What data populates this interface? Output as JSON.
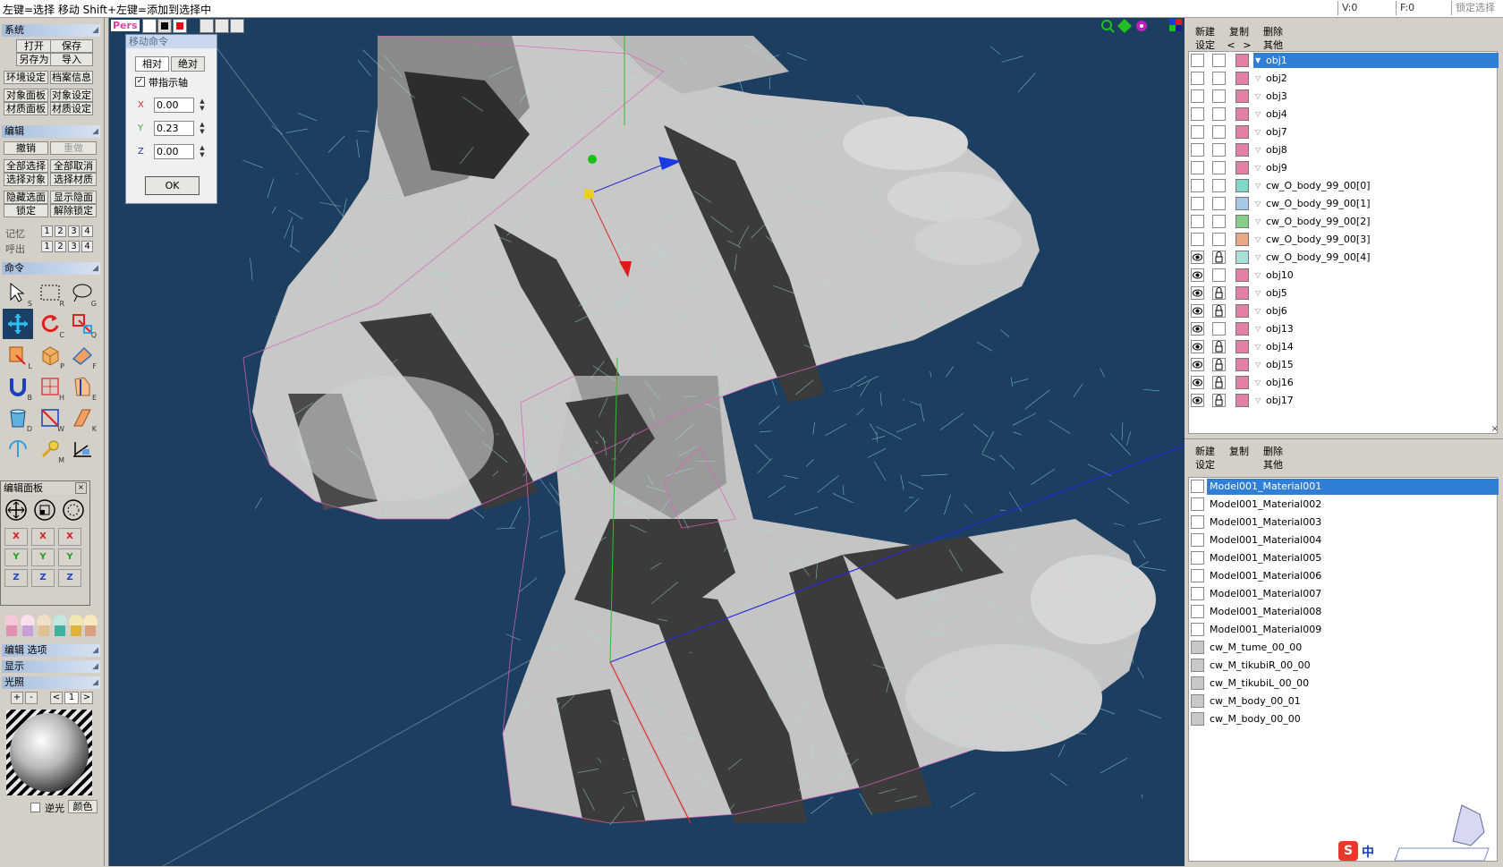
{
  "statusbar": {
    "hint": "左键=选择 移动  Shift+左键=添加到选择中",
    "v": "V:0",
    "f": "F:0",
    "lock": "锁定选择"
  },
  "left": {
    "system_title": "系统",
    "system_buttons": [
      "打开",
      "保存",
      "另存为",
      "导入",
      "环境设定",
      "档案信息",
      "对象面板",
      "对象设定",
      "材质面板",
      "材质设定"
    ],
    "edit_title": "编辑",
    "edit_buttons": [
      "撤销",
      "重做",
      "全部选择",
      "全部取消",
      "选择对象",
      "选择材质",
      "隐藏选面",
      "显示隐面",
      "锁定",
      "解除锁定"
    ],
    "memory_label": "记忆",
    "recall_label": "呼出",
    "slots": [
      "1",
      "2",
      "3",
      "4"
    ],
    "command_title": "命令",
    "tool_keys": [
      "S",
      "R",
      "G",
      "V",
      "C",
      "Q",
      "L",
      "P",
      "F",
      "B",
      "H",
      "E",
      "D",
      "W",
      "K",
      "",
      "M",
      ""
    ],
    "palette_title": "编辑面板",
    "axes": [
      "X",
      "Y",
      "Z"
    ],
    "edit_options": "编辑 选项",
    "display": "显示",
    "light": "光照",
    "light_controls": [
      "+",
      "-",
      "<",
      "1",
      ">"
    ],
    "invert_light": "逆光",
    "color_btn": "颜色"
  },
  "viewport": {
    "view_mode": "Pers"
  },
  "move_dialog": {
    "caption": "移动命令",
    "relative": "相对",
    "absolute": "绝对",
    "with_axis": "带指示轴",
    "x_label": "X",
    "x_value": "0.00",
    "y_label": "Y",
    "y_value": "0.23",
    "z_label": "Z",
    "z_value": "0.00",
    "ok": "OK"
  },
  "objects_panel": {
    "buttons": [
      "新建",
      "复制",
      "删除",
      "设定",
      "<",
      ">",
      "其他"
    ],
    "rows": [
      {
        "name": "obj1",
        "color": "#e47fa8",
        "visible": false,
        "locked": false,
        "selected": true,
        "expanded": true
      },
      {
        "name": "obj2",
        "color": "#e47fa8",
        "visible": false,
        "locked": false
      },
      {
        "name": "obj3",
        "color": "#e47fa8",
        "visible": false,
        "locked": false
      },
      {
        "name": "obj4",
        "color": "#e47fa8",
        "visible": false,
        "locked": false
      },
      {
        "name": "obj7",
        "color": "#e47fa8",
        "visible": false,
        "locked": false
      },
      {
        "name": "obj8",
        "color": "#e47fa8",
        "visible": false,
        "locked": false
      },
      {
        "name": "obj9",
        "color": "#e47fa8",
        "visible": false,
        "locked": false
      },
      {
        "name": "cw_O_body_99_00[0]",
        "color": "#7fd8c8",
        "visible": false,
        "locked": false
      },
      {
        "name": "cw_O_body_99_00[1]",
        "color": "#a8c8e8",
        "visible": false,
        "locked": false
      },
      {
        "name": "cw_O_body_99_00[2]",
        "color": "#88cc88",
        "visible": false,
        "locked": false
      },
      {
        "name": "cw_O_body_99_00[3]",
        "color": "#e8a888",
        "visible": false,
        "locked": false
      },
      {
        "name": "cw_O_body_99_00[4]",
        "color": "#a8e0d8",
        "visible": true,
        "locked": true
      },
      {
        "name": "obj10",
        "color": "#e47fa8",
        "visible": true,
        "locked": false
      },
      {
        "name": "obj5",
        "color": "#e47fa8",
        "visible": true,
        "locked": true
      },
      {
        "name": "obj6",
        "color": "#e47fa8",
        "visible": true,
        "locked": true
      },
      {
        "name": "obj13",
        "color": "#e47fa8",
        "visible": true,
        "locked": false
      },
      {
        "name": "obj14",
        "color": "#e47fa8",
        "visible": true,
        "locked": true
      },
      {
        "name": "obj15",
        "color": "#e47fa8",
        "visible": true,
        "locked": true
      },
      {
        "name": "obj16",
        "color": "#e47fa8",
        "visible": true,
        "locked": true
      },
      {
        "name": "obj17",
        "color": "#e47fa8",
        "visible": true,
        "locked": true
      }
    ]
  },
  "materials_panel": {
    "buttons": [
      "新建",
      "复制",
      "删除",
      "设定",
      "其他"
    ],
    "rows": [
      {
        "name": "Model001_Material001",
        "selected": true,
        "gray": false
      },
      {
        "name": "Model001_Material002",
        "gray": false
      },
      {
        "name": "Model001_Material003",
        "gray": false
      },
      {
        "name": "Model001_Material004",
        "gray": false
      },
      {
        "name": "Model001_Material005",
        "gray": false
      },
      {
        "name": "Model001_Material006",
        "gray": false
      },
      {
        "name": "Model001_Material007",
        "gray": false
      },
      {
        "name": "Model001_Material008",
        "gray": false
      },
      {
        "name": "Model001_Material009",
        "gray": false
      },
      {
        "name": "cw_M_tume_00_00",
        "gray": true
      },
      {
        "name": "cw_M_tikubiR_00_00",
        "gray": true
      },
      {
        "name": "cw_M_tikubiL_00_00",
        "gray": true
      },
      {
        "name": "cw_M_body_00_01",
        "gray": true
      },
      {
        "name": "cw_M_body_00_00",
        "gray": true
      }
    ]
  },
  "watermark": {
    "ime": "中"
  }
}
